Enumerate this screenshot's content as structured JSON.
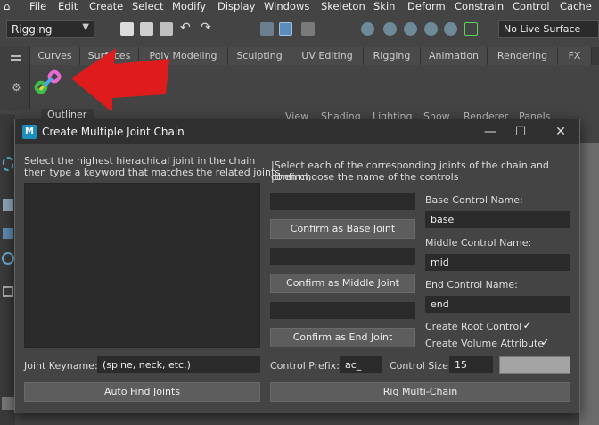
{
  "menubar": {
    "items": [
      "File",
      "Edit",
      "Create",
      "Select",
      "Modify",
      "Display",
      "Windows",
      "Skeleton",
      "Skin",
      "Deform",
      "Constrain",
      "Control",
      "Cache"
    ]
  },
  "toolbar": {
    "mode": "Rigging",
    "live_surface": "No Live Surface"
  },
  "shelf": {
    "tabs": [
      "Curves",
      "Surfaces",
      "Poly Modeling",
      "Sculpting",
      "UV Editing",
      "Rigging",
      "Animation",
      "Rendering",
      "FX"
    ]
  },
  "panels": {
    "outliner": "Outliner",
    "viewport_menu": [
      "View",
      "Shading",
      "Lighting",
      "Show",
      "Renderer",
      "Panels"
    ]
  },
  "dialog": {
    "title": "Create Multiple Joint Chain",
    "app_icon": "M",
    "left_instructions_1": "Select the highest hierachical joint in the chain",
    "left_instructions_2": "then type a keyword that matches the related joints",
    "right_instructions_1": "|Select each of the corresponding joints of the chain and confirm,",
    "right_instructions_2": "|then choose the name of the controls",
    "joint_keyname_label": "Joint Keyname:",
    "joint_keyname_value": "(spine, neck, etc.)",
    "auto_find_button": "Auto Find Joints",
    "base_joint_value": "",
    "confirm_base_button": "Confirm as Base Joint",
    "middle_joint_value": "",
    "confirm_middle_button": "Confirm as Middle Joint",
    "end_joint_value": "",
    "confirm_end_button": "Confirm as End Joint",
    "base_control_label": "Base Control Name:",
    "base_control_value": "base",
    "middle_control_label": "Middle Control Name:",
    "middle_control_value": "mid",
    "end_control_label": "End Control Name:",
    "end_control_value": "end",
    "create_root_label": "Create Root Control",
    "create_root_checked": true,
    "create_volume_label": "Create Volume Attribute",
    "create_volume_checked": true,
    "check_mark": "✓",
    "control_prefix_label": "Control Prefix:",
    "control_prefix_value": "ac_",
    "control_size_label": "Control Size",
    "control_size_value": "15",
    "control_color": "#a4a4a4",
    "rig_button": "Rig Multi-Chain"
  },
  "annotation_arrow_color": "#e01b1b"
}
